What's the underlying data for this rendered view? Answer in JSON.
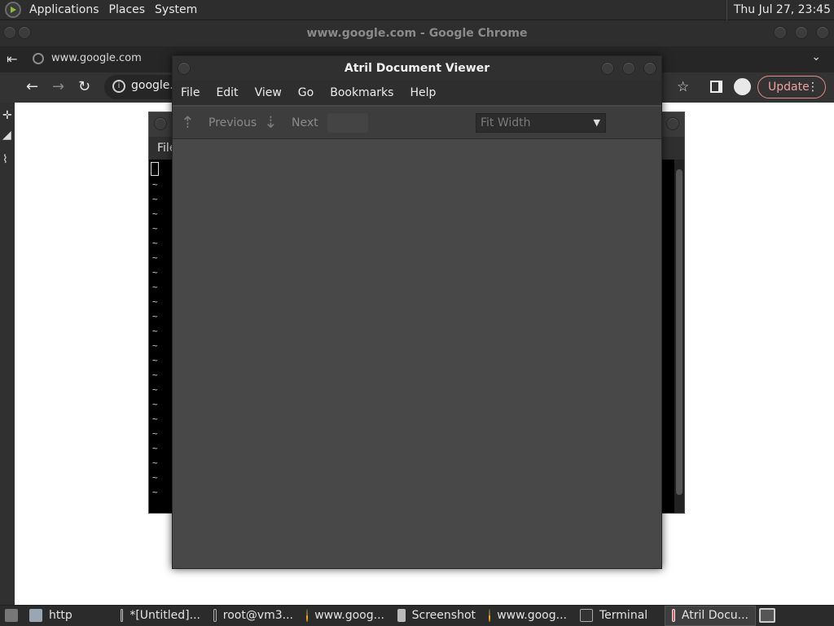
{
  "top_panel": {
    "menus": [
      "Applications",
      "Places",
      "System"
    ],
    "clock": "Thu Jul 27, 23:45"
  },
  "chrome": {
    "title": "www.google.com - Google Chrome",
    "tab_url": "www.google.com",
    "address": "google.c",
    "update_label": "Update"
  },
  "terminal": {
    "menu_file": "File",
    "tildes": [
      "~",
      "~",
      "~",
      "~",
      "~",
      "~",
      "~",
      "~",
      "~",
      "~",
      "~",
      "~",
      "~",
      "~",
      "~",
      "~",
      "~",
      "~",
      "~",
      "~",
      "~",
      "~"
    ]
  },
  "atril": {
    "title": "Atril Document Viewer",
    "menus": [
      "File",
      "Edit",
      "View",
      "Go",
      "Bookmarks",
      "Help"
    ],
    "previous_label": "Previous",
    "next_label": "Next",
    "zoom_value": "Fit Width"
  },
  "taskbar": {
    "items": [
      {
        "label": "http",
        "icon": "folder-icon"
      },
      {
        "label": "*[Untitled]...",
        "icon": "inkscape-icon"
      },
      {
        "label": "root@vm3...",
        "icon": "terminal-icon"
      },
      {
        "label": "www.goog...",
        "icon": "chrome-icon"
      },
      {
        "label": "Screenshot",
        "icon": "screenshot-icon"
      },
      {
        "label": "www.goog...",
        "icon": "chrome-icon"
      },
      {
        "label": "Terminal",
        "icon": "terminal-icon"
      },
      {
        "label": "Atril Docu...",
        "icon": "atril-icon"
      }
    ]
  }
}
